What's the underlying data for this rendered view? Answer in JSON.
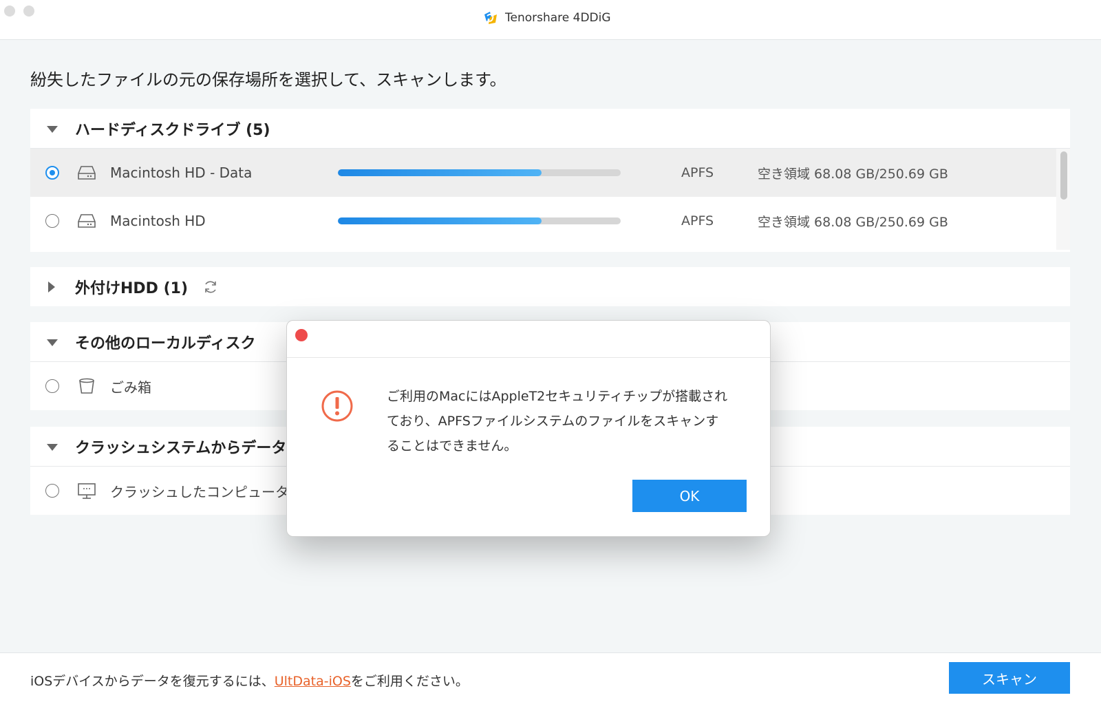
{
  "window": {
    "app_title": "Tenorshare 4DDiG",
    "logo_icon": "4ddig-logo-icon"
  },
  "main": {
    "heading": "紛失したファイルの元の保存場所を選択して、スキャンします。"
  },
  "sections": {
    "hdd": {
      "title": "ハードディスクドライブ (5)",
      "expanded": true,
      "drives": [
        {
          "label": "Macintosh HD - Data",
          "selected": true,
          "usage_percent": 72,
          "filesystem": "APFS",
          "space": "空き領域 68.08 GB/250.69 GB",
          "icon": "hard-drive-icon"
        },
        {
          "label": "Macintosh HD",
          "selected": false,
          "usage_percent": 72,
          "filesystem": "APFS",
          "space": "空き領域 68.08 GB/250.69 GB",
          "icon": "hard-drive-icon"
        }
      ]
    },
    "external": {
      "title": "外付けHDD (1)",
      "expanded": false,
      "refresh_icon": "refresh-icon"
    },
    "other_local": {
      "title": "その他のローカルディスク",
      "expanded": true,
      "items": [
        {
          "label": "ごみ箱",
          "icon": "trash-icon"
        }
      ]
    },
    "crash": {
      "title": "クラッシュシステムからデータ",
      "expanded": true,
      "items": [
        {
          "label": "クラッシュしたコンピュータ",
          "icon": "computer-icon"
        }
      ]
    }
  },
  "footer": {
    "text_before": "iOSデバイスからデータを復元するには、",
    "link": "UltData-iOS",
    "text_after": "をご利用ください。",
    "scan_button": "スキャン"
  },
  "dialog": {
    "message": "ご利用のMacにはAppleT2セキュリティチップが搭載されており、APFSファイルシステムのファイルをスキャンすることはできません。",
    "ok_button": "OK",
    "icon": "alert-icon"
  },
  "colors": {
    "accent": "#1e8fee",
    "link": "#e8622a",
    "alert": "#f06a4a"
  }
}
